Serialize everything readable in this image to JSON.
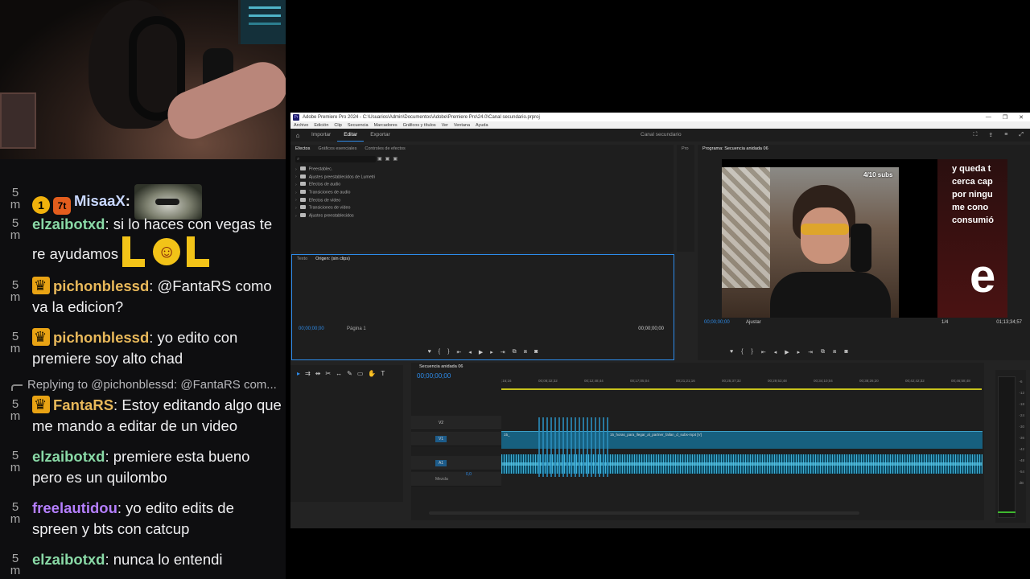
{
  "chat": {
    "messages": [
      {
        "ts": "5 m",
        "user": "MisaaX",
        "user_color": "#c8d7ff",
        "badges": [
          "1",
          "7t"
        ],
        "text": "",
        "emote": "cat"
      },
      {
        "ts": "5 m",
        "user": "elzaibotxd",
        "user_color": "#89d9a6",
        "text": " si lo haces con vegas te re ayudamos ",
        "emote": "LOL"
      },
      {
        "ts": "5 m",
        "user": "pichonblessd",
        "user_color": "#e8b85a",
        "badges": [
          "crown"
        ],
        "text": " @FantaRS como va la edicion?"
      },
      {
        "ts": "5 m",
        "user": "pichonblessd",
        "user_color": "#e8b85a",
        "badges": [
          "crown"
        ],
        "text": " yo edito con premiere soy alto chad"
      },
      {
        "ts": "5 m",
        "user": "FantaRS",
        "user_color": "#e8b85a",
        "badges": [
          "crown"
        ],
        "text": " Estoy editando algo que me mando a editar de un video",
        "reply": {
          "prefix": "Replying to ",
          "to": "@pichonblessd:",
          "text": " @FantaRS com..."
        }
      },
      {
        "ts": "5 m",
        "user": "elzaibotxd",
        "user_color": "#89d9a6",
        "text": " premiere esta bueno pero es un quilombo"
      },
      {
        "ts": "5 m",
        "user": "freelautidou",
        "user_color": "#b57fff",
        "text": " yo edito edits de spreen y bts con catcup"
      },
      {
        "ts": "5 m",
        "user": "elzaibotxd",
        "user_color": "#89d9a6",
        "text": " nunca lo entendi"
      }
    ]
  },
  "premiere": {
    "title": "Adobe Premiere Pro 2024 - C:\\Usuarios\\Admin\\Documentos\\Adobe\\Premiere Pro\\24.0\\Canal secundario.prproj",
    "app_icon": "Pr",
    "menu": [
      "Archivo",
      "Edición",
      "Clip",
      "Secuencia",
      "Marcadores",
      "Gráficos y títulos",
      "Ver",
      "Ventana",
      "Ayuda"
    ],
    "workspaces": [
      "Importar",
      "Editar",
      "Exportar"
    ],
    "active_workspace": "Editar",
    "project_name": "Canal secundario",
    "effects_panel": {
      "tabs": [
        "Efectos",
        "Gráficos esenciales",
        "Controles de efectos"
      ],
      "items": [
        "Preestablec.",
        "Ajustes preestablecidos de Lumetri",
        "Efectos de audio",
        "Transiciones de audio",
        "Efectos de vídeo",
        "Transiciones de vídeo",
        "Ajustes preestablecidos"
      ]
    },
    "pr_tab": "Pro",
    "source_panel": {
      "tabs": [
        "Texto",
        "Origen: (sin clips)"
      ],
      "timecode_left": "00;00;00;00",
      "page_label": "Página 1",
      "timecode_right": "00;00;00;00"
    },
    "program_panel": {
      "tab": "Programa: Secuencia anidada 06",
      "video_subs_badge": "4/10 subs",
      "video_caption_lines": [
        "y queda t",
        "cerca cap",
        "por ningu",
        "me cono",
        "consumió"
      ],
      "video_big_letter": "e",
      "timecode_left": "00;00;00;00",
      "fit_label": "Ajustar",
      "quality": "1/4",
      "timecode_right": "01;13;34;57"
    },
    "timeline": {
      "tab": "Secuencia anidada 06",
      "timecode": "00;00;00;00",
      "ruler": [
        ";16;16",
        "00;08;32;32",
        "00;12;48;44",
        "00;17;05;04",
        "00;21;21;16",
        "00;25;37;32",
        "00;29;53;48",
        "00;34;10;04",
        "00;38;26;20",
        "00;42;42;32",
        "00;46;58;48"
      ],
      "tracks": [
        "V2",
        "V1",
        "A1"
      ],
      "mix_label": "Mezcla",
      "mix_value": "0,0",
      "clip_label": "15_horas_para_llegar_al_partner_fallan_d_subs-mp4 [V]",
      "clip_short": "15_",
      "meter_scale": [
        "-6",
        "-12",
        "-18",
        "-24",
        "-30",
        "-36",
        "-42",
        "-48",
        "-54",
        "dB"
      ]
    }
  }
}
